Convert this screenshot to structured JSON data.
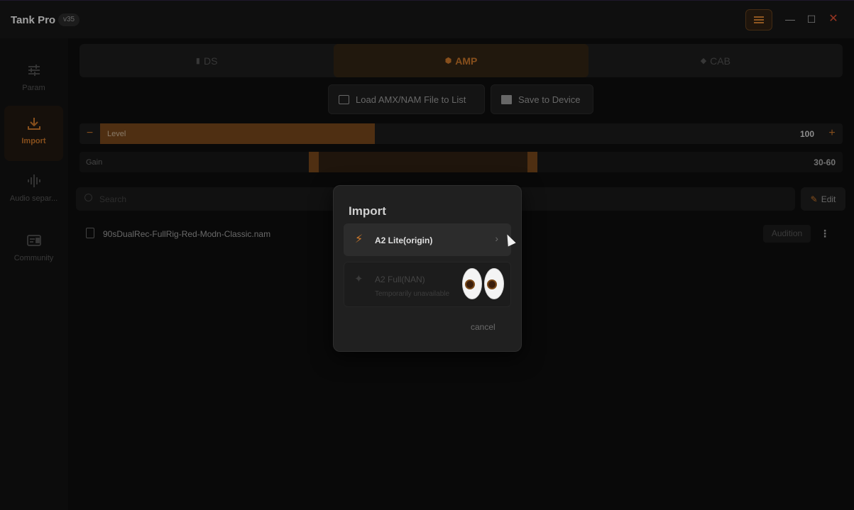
{
  "app": {
    "title": "Tank Pro",
    "version": "v35"
  },
  "window_controls": {
    "menu_icon": "hamburger-icon",
    "minimize": "—",
    "maximize": "☐",
    "close": "✕"
  },
  "sidebar": {
    "items": [
      {
        "label": "Param",
        "icon": "sliders-icon",
        "active": false
      },
      {
        "label": "Import",
        "icon": "download-icon",
        "active": true
      },
      {
        "label": "Audio separ...",
        "icon": "waveform-icon",
        "active": false
      },
      {
        "label": "Community",
        "icon": "community-icon",
        "active": false
      }
    ]
  },
  "tabs": [
    {
      "label": "DS",
      "icon": "pedal-icon",
      "active": false
    },
    {
      "label": "AMP",
      "icon": "amp-icon",
      "active": true
    },
    {
      "label": "CAB",
      "icon": "cab-icon",
      "active": false
    }
  ],
  "actions": {
    "load_label": "Load AMX/NAM File to List",
    "save_label": "Save to Device"
  },
  "level": {
    "label": "Level",
    "value": "100",
    "fill_fraction": 0.37
  },
  "gain": {
    "label": "Gain",
    "value": "30-60",
    "range": [
      0.3,
      0.6
    ]
  },
  "search": {
    "placeholder": "Search"
  },
  "edit_label": "Edit",
  "files": [
    {
      "name": "90sDualRec-FullRig-Red-Modn-Classic.nam",
      "audition_label": "Audition"
    }
  ],
  "modal": {
    "title": "Import",
    "options": [
      {
        "label": "A2 Lite(origin)",
        "icon": "lightning-icon",
        "enabled": true
      },
      {
        "label": "A2 Full(NAN)",
        "sublabel": "Temporarily unavailable",
        "icon": "sparkle-icon",
        "enabled": false
      }
    ],
    "cancel_label": "cancel"
  },
  "colors": {
    "accent": "#b56a26",
    "background": "#0c0c0c"
  }
}
